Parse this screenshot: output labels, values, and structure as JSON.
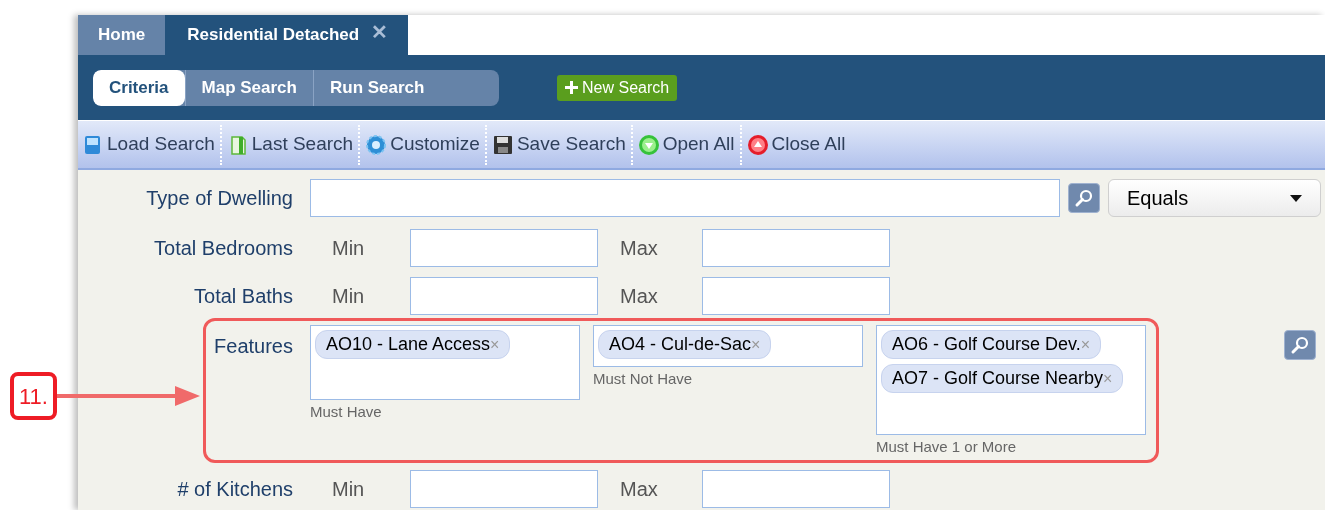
{
  "tabs": [
    {
      "label": "Home",
      "selected": false
    },
    {
      "label": "Residential Detached",
      "selected": true,
      "close": "✕"
    }
  ],
  "subtabs": [
    {
      "label": "Criteria",
      "selected": true
    },
    {
      "label": "Map Search",
      "selected": false
    },
    {
      "label": "Run Search",
      "selected": false
    }
  ],
  "new_search_button": {
    "label": "New Search"
  },
  "toolbar": [
    {
      "label": "Load Search",
      "kind": "load"
    },
    {
      "label": "Last Search",
      "kind": "last"
    },
    {
      "label": "Customize",
      "kind": "customize"
    },
    {
      "label": "Save Search",
      "kind": "save"
    },
    {
      "label": "Open All",
      "kind": "open"
    },
    {
      "label": "Close All",
      "kind": "close"
    }
  ],
  "rows": [
    {
      "kind": "lookup",
      "label": "Type of Dwelling",
      "operator": "Equals"
    },
    {
      "kind": "range",
      "label": "Total Bedrooms",
      "min_label": "Min",
      "max_label": "Max"
    },
    {
      "kind": "range",
      "label": "Total Baths",
      "min_label": "Min",
      "max_label": "Max"
    },
    {
      "kind": "features",
      "label": "Features",
      "groups": [
        {
          "caption": "Must Have",
          "tags": [
            {
              "label": "AO10 - Lane Access",
              "remove": "×"
            }
          ]
        },
        {
          "caption": "Must Not Have",
          "tags": [
            {
              "label": "AO4 - Cul-de-Sac",
              "remove": "×"
            }
          ]
        },
        {
          "caption": "Must Have 1 or More",
          "tags": [
            {
              "label": "AO6 - Golf Course Dev.",
              "remove": "×"
            },
            {
              "label": "AO7 - Golf Course Nearby",
              "remove": "×"
            }
          ]
        }
      ]
    },
    {
      "kind": "range",
      "label": "# of Kitchens",
      "min_label": "Min",
      "max_label": "Max"
    }
  ],
  "callout": {
    "label": "11."
  }
}
